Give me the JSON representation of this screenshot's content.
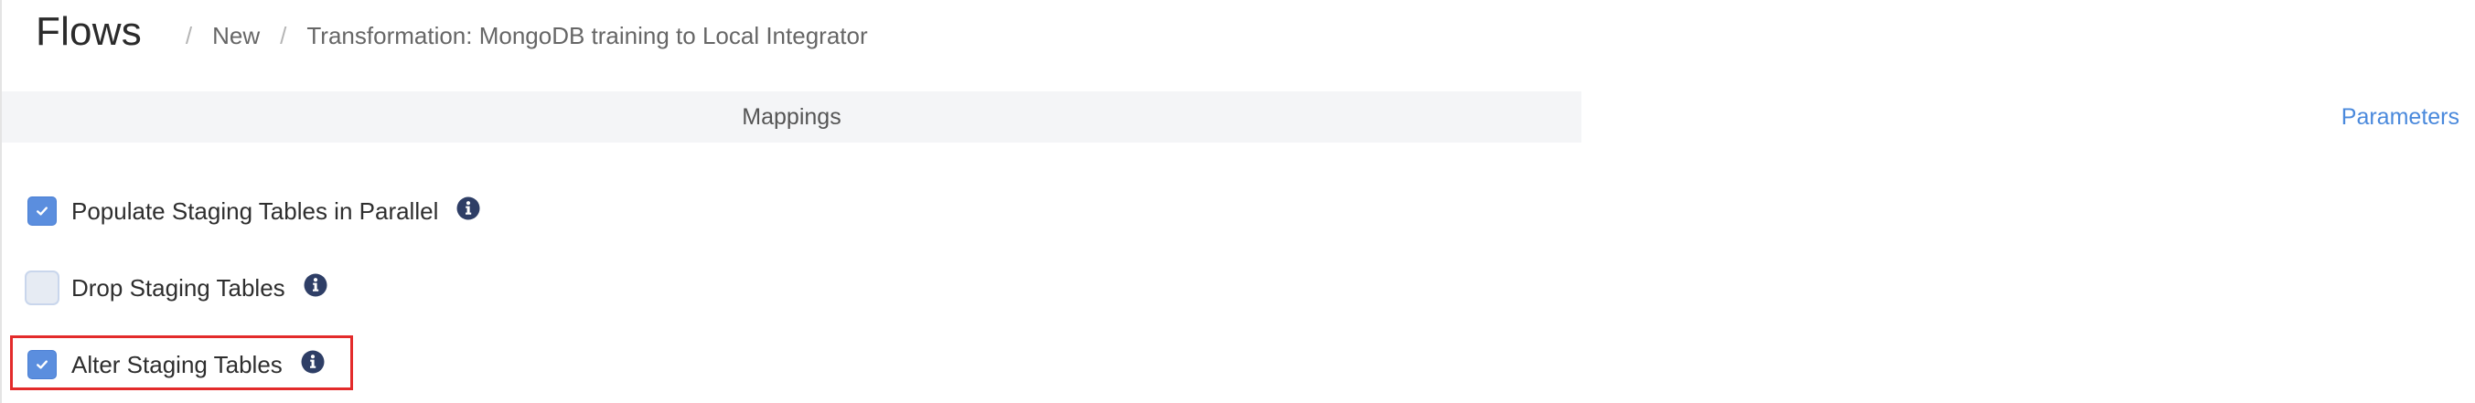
{
  "header": {
    "title": "Flows",
    "breadcrumb": [
      {
        "label": "New"
      },
      {
        "label": "Transformation: MongoDB training to Local Integrator"
      }
    ],
    "separator": "/"
  },
  "tabs": [
    {
      "label": "Mappings",
      "active": true
    },
    {
      "label": "Parameters",
      "active": false
    }
  ],
  "options": [
    {
      "label": "Populate Staging Tables in Parallel",
      "checked": true,
      "icon": "info-circle-icon"
    },
    {
      "label": "Drop Staging Tables",
      "checked": false,
      "icon": "info-circle-icon"
    },
    {
      "label": "Alter Staging Tables",
      "checked": true,
      "icon": "info-circle-icon",
      "highlighted": true
    }
  ],
  "colors": {
    "accent": "#4a89dc",
    "checkbox_checked": "#5b8ede",
    "info_icon": "#2e3e66",
    "highlight": "#e32b2b",
    "tab_bg": "#f4f5f7"
  }
}
